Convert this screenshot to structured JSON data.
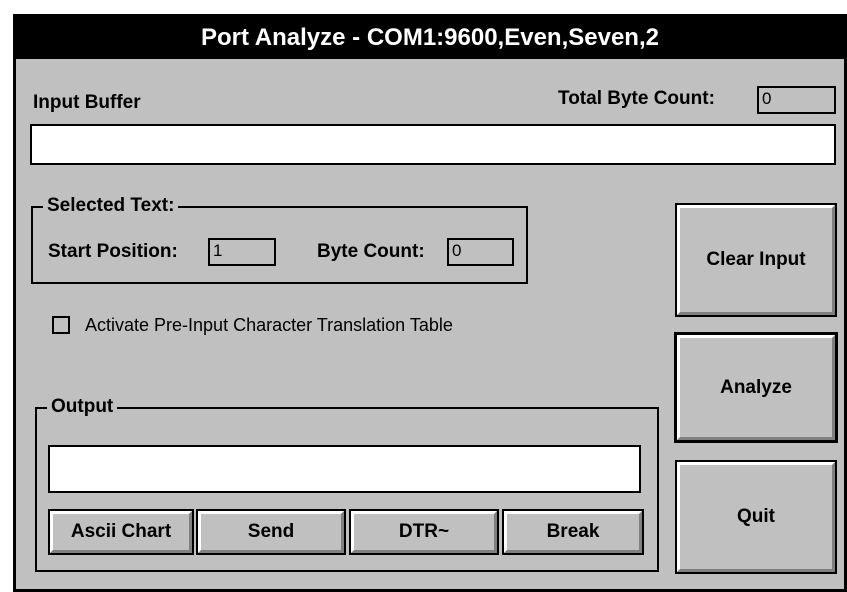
{
  "window": {
    "title": "Port Analyze - COM1:9600,Even,Seven,2"
  },
  "input_buffer": {
    "label": "Input Buffer",
    "value": ""
  },
  "total_byte_count": {
    "label": "Total Byte Count:",
    "value": "0"
  },
  "selected_text": {
    "title": "Selected Text:",
    "start_position_label": "Start Position:",
    "start_position_value": "1",
    "byte_count_label": "Byte Count:",
    "byte_count_value": "0"
  },
  "translation_table": {
    "label": "Activate Pre-Input Character Translation Table",
    "checked": false
  },
  "output": {
    "title": "Output",
    "value": "",
    "buttons": [
      "Ascii Chart",
      "Send",
      "DTR~",
      "Break"
    ]
  },
  "side_buttons": {
    "clear_input": "Clear Input",
    "analyze": "Analyze",
    "quit": "Quit"
  }
}
